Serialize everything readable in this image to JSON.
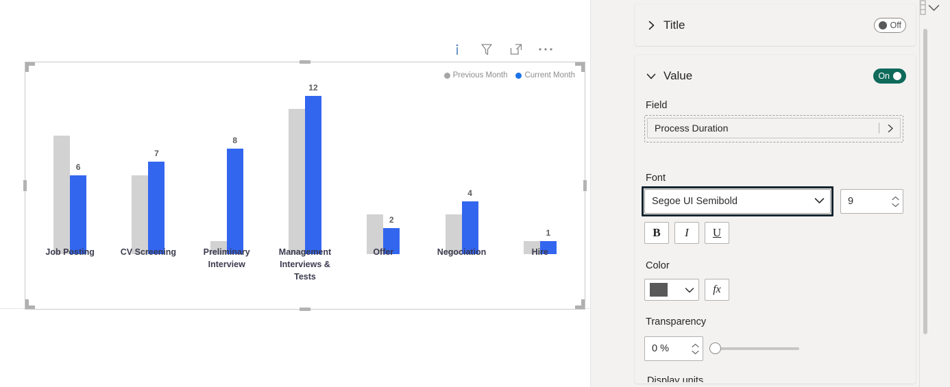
{
  "canvas": {
    "toolbar": [
      {
        "name": "info-icon",
        "label": "Info"
      },
      {
        "name": "filter-icon",
        "label": "Filters"
      },
      {
        "name": "focus-mode-icon",
        "label": "Focus mode"
      },
      {
        "name": "more-options-icon",
        "label": "More options"
      }
    ]
  },
  "chart_data": {
    "type": "bar",
    "title": "",
    "xlabel": "",
    "ylabel": "",
    "grid": false,
    "legend_position": "top-right",
    "categories": [
      "Job Posting",
      "CV Screening",
      "Preliminary Interview",
      "Management Interviews & Tests",
      "Offer",
      "Negociation",
      "Hire"
    ],
    "category_lines": [
      [
        "Job Posting"
      ],
      [
        "CV Screening"
      ],
      [
        "Preliminary",
        "Interview"
      ],
      [
        "Management",
        "Interviews &",
        "Tests"
      ],
      [
        "Offer"
      ],
      [
        "Negociation"
      ],
      [
        "Hire"
      ]
    ],
    "series": [
      {
        "name": "Previous Month",
        "color": "#d2d2d2",
        "values": [
          9,
          6,
          1,
          11,
          3,
          3,
          1
        ],
        "labels": [
          "",
          "",
          "",
          "",
          "",
          "",
          ""
        ]
      },
      {
        "name": "Current Month",
        "color": "#3366ef",
        "values": [
          6,
          7,
          8,
          12,
          2,
          4,
          1
        ],
        "labels": [
          "6",
          "7",
          "8",
          "12",
          "2",
          "4",
          "1"
        ]
      }
    ],
    "ylim": [
      0,
      13
    ]
  },
  "pane": {
    "title_card": {
      "label": "Title",
      "chevron": "chevron-right-icon",
      "toggle": {
        "state": "off",
        "label": "Off"
      }
    },
    "value_card": {
      "label": "Value",
      "chevron": "chevron-down-icon",
      "toggle": {
        "state": "on",
        "label": "On"
      },
      "field_label": "Field",
      "field_chip": "Process Duration",
      "font_label": "Font",
      "font_family": "Segoe UI Semibold",
      "font_size": "9",
      "bold_label": "B",
      "italic_label": "I",
      "underline_label": "U",
      "color_label": "Color",
      "color_value": "#595959",
      "fx_label": "fx",
      "transparency_label": "Transparency",
      "transparency_value": "0 %",
      "next_section_label": "Display units"
    },
    "focus_color": "#15252e",
    "accent_on_color": "#0f6a5a"
  }
}
